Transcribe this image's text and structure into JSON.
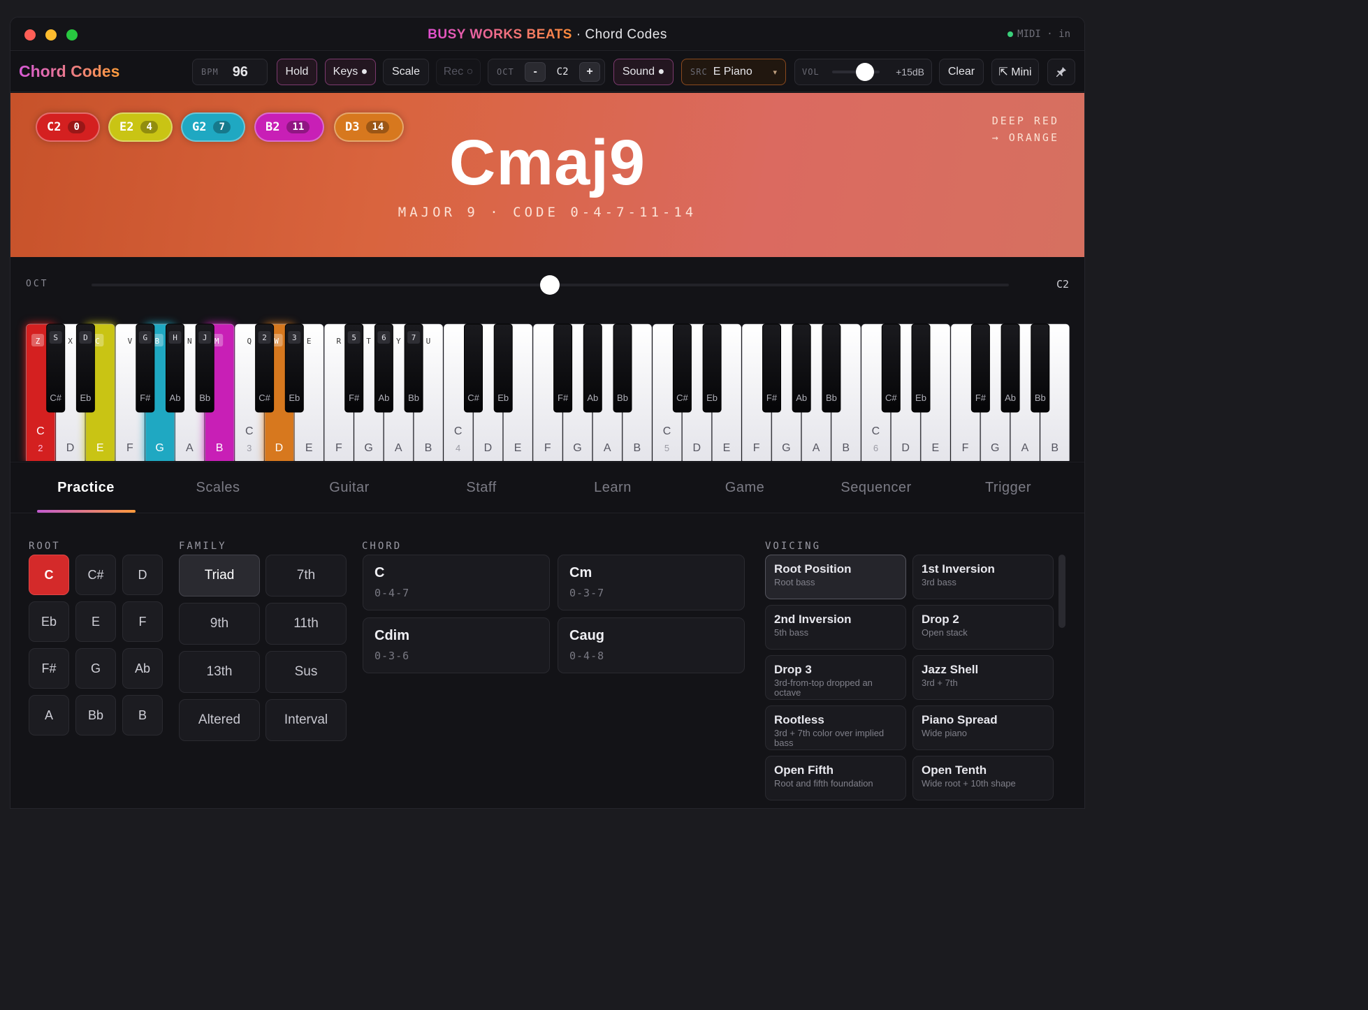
{
  "window": {
    "title_brand": "BUSY WORKS BEATS",
    "title_rest": " · Chord Codes",
    "midi_status": "MIDI · in"
  },
  "toolbar": {
    "app_name": "Chord Codes",
    "bpm_label": "BPM",
    "bpm_value": "96",
    "hold": "Hold",
    "keys": "Keys ●",
    "scale": "Scale",
    "rec": "Rec ○",
    "oct_label": "OCT",
    "oct_minus": "-",
    "oct_value": "C2",
    "oct_plus": "+",
    "sound": "Sound ●",
    "src_label": "SRC",
    "src_value": "E Piano",
    "src_arrow": "▾",
    "vol_label": "VOL",
    "vol_value": "+15dB",
    "vol_level": 0.7,
    "clear": "Clear",
    "mini": "⇱ Mini",
    "pin_icon": "pin-icon"
  },
  "hero": {
    "notes": [
      {
        "name": "C2",
        "num": "0",
        "color": "#d42020"
      },
      {
        "name": "E2",
        "num": "4",
        "color": "#c9c414"
      },
      {
        "name": "G2",
        "num": "7",
        "color": "#1fa8c2"
      },
      {
        "name": "B2",
        "num": "11",
        "color": "#c81fb6"
      },
      {
        "name": "D3",
        "num": "14",
        "color": "#d7781e"
      }
    ],
    "chord_name": "Cmaj9",
    "subtitle": "MAJOR 9 · CODE 0-4-7-11-14",
    "color_line1": "DEEP RED",
    "color_line2": "→ ORANGE"
  },
  "octave_slider": {
    "label": "OCT",
    "value": "C2"
  },
  "keyboard": {
    "white_keys": [
      {
        "note": "C",
        "oct": "2",
        "shortcut": "Z",
        "color": "#d42020"
      },
      {
        "note": "D",
        "shortcut": "X"
      },
      {
        "note": "E",
        "shortcut": "C",
        "color": "#c9c414"
      },
      {
        "note": "F",
        "shortcut": "V"
      },
      {
        "note": "G",
        "shortcut": "B",
        "color": "#1fa8c2"
      },
      {
        "note": "A",
        "shortcut": "N"
      },
      {
        "note": "B",
        "shortcut": "M",
        "color": "#c81fb6"
      },
      {
        "note": "C",
        "oct": "3",
        "shortcut": "Q"
      },
      {
        "note": "D",
        "shortcut": "W",
        "color": "#d7781e"
      },
      {
        "note": "E",
        "shortcut": "E"
      },
      {
        "note": "F",
        "shortcut": "R"
      },
      {
        "note": "G",
        "shortcut": "T"
      },
      {
        "note": "A",
        "shortcut": "Y"
      },
      {
        "note": "B",
        "shortcut": "U"
      },
      {
        "note": "C",
        "oct": "4"
      },
      {
        "note": "D"
      },
      {
        "note": "E"
      },
      {
        "note": "F"
      },
      {
        "note": "G"
      },
      {
        "note": "A"
      },
      {
        "note": "B"
      },
      {
        "note": "C",
        "oct": "5"
      },
      {
        "note": "D"
      },
      {
        "note": "E"
      },
      {
        "note": "F"
      },
      {
        "note": "G"
      },
      {
        "note": "A"
      },
      {
        "note": "B"
      },
      {
        "note": "C",
        "oct": "6"
      },
      {
        "note": "D"
      },
      {
        "note": "E"
      },
      {
        "note": "F"
      },
      {
        "note": "G"
      },
      {
        "note": "A"
      },
      {
        "note": "B"
      }
    ],
    "black_keys": [
      {
        "note": "C#",
        "shortcut": "S",
        "after": 0
      },
      {
        "note": "Eb",
        "shortcut": "D",
        "after": 1
      },
      {
        "note": "F#",
        "shortcut": "G",
        "after": 3
      },
      {
        "note": "Ab",
        "shortcut": "H",
        "after": 4
      },
      {
        "note": "Bb",
        "shortcut": "J",
        "after": 5
      },
      {
        "note": "C#",
        "shortcut": "2",
        "after": 7
      },
      {
        "note": "Eb",
        "shortcut": "3",
        "after": 8
      },
      {
        "note": "F#",
        "shortcut": "5",
        "after": 10
      },
      {
        "note": "Ab",
        "shortcut": "6",
        "after": 11
      },
      {
        "note": "Bb",
        "shortcut": "7",
        "after": 12
      },
      {
        "note": "C#",
        "after": 14
      },
      {
        "note": "Eb",
        "after": 15
      },
      {
        "note": "F#",
        "after": 17
      },
      {
        "note": "Ab",
        "after": 18
      },
      {
        "note": "Bb",
        "after": 19
      },
      {
        "note": "C#",
        "after": 21
      },
      {
        "note": "Eb",
        "after": 22
      },
      {
        "note": "F#",
        "after": 24
      },
      {
        "note": "Ab",
        "after": 25
      },
      {
        "note": "Bb",
        "after": 26
      },
      {
        "note": "C#",
        "after": 28
      },
      {
        "note": "Eb",
        "after": 29
      },
      {
        "note": "F#",
        "after": 31
      },
      {
        "note": "Ab",
        "after": 32
      },
      {
        "note": "Bb",
        "after": 33
      }
    ]
  },
  "tabs": [
    "Practice",
    "Scales",
    "Guitar",
    "Staff",
    "Learn",
    "Game",
    "Sequencer",
    "Trigger"
  ],
  "root": {
    "label": "ROOT",
    "keys": [
      "C",
      "C#",
      "D",
      "Eb",
      "E",
      "F",
      "F#",
      "G",
      "Ab",
      "A",
      "Bb",
      "B"
    ],
    "selected": "C"
  },
  "family": {
    "label": "FAMILY",
    "items": [
      "Triad",
      "7th",
      "9th",
      "11th",
      "13th",
      "Sus",
      "Altered",
      "Interval"
    ],
    "selected": "Triad"
  },
  "chord": {
    "label": "CHORD",
    "items": [
      {
        "name": "C",
        "code": "0-4-7"
      },
      {
        "name": "Cm",
        "code": "0-3-7"
      },
      {
        "name": "Cdim",
        "code": "0-3-6"
      },
      {
        "name": "Caug",
        "code": "0-4-8"
      }
    ]
  },
  "voicing": {
    "label": "VOICING",
    "items": [
      {
        "name": "Root Position",
        "desc": "Root bass"
      },
      {
        "name": "1st Inversion",
        "desc": "3rd bass"
      },
      {
        "name": "2nd Inversion",
        "desc": "5th bass"
      },
      {
        "name": "Drop 2",
        "desc": "Open stack"
      },
      {
        "name": "Drop 3",
        "desc": "3rd-from-top dropped an octave"
      },
      {
        "name": "Jazz Shell",
        "desc": "3rd + 7th"
      },
      {
        "name": "Rootless",
        "desc": "3rd + 7th color over implied bass"
      },
      {
        "name": "Piano Spread",
        "desc": "Wide piano"
      },
      {
        "name": "Open Fifth",
        "desc": "Root and fifth foundation"
      },
      {
        "name": "Open Tenth",
        "desc": "Wide root + 10th shape"
      }
    ],
    "selected": "Root Position"
  }
}
